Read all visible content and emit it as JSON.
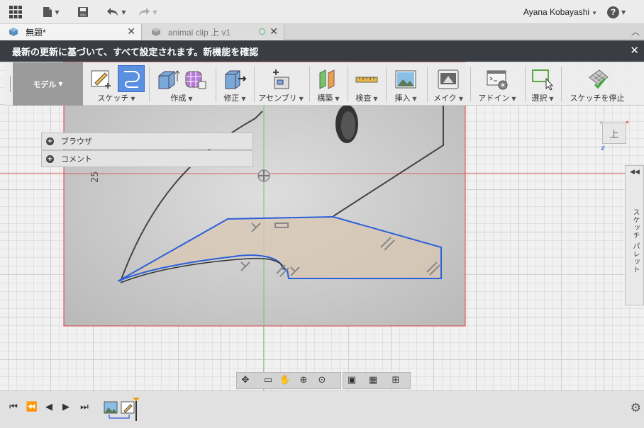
{
  "header": {
    "user_name": "Ayana Kobayashi",
    "help_label": "?"
  },
  "tabs": [
    {
      "label": "無題*"
    },
    {
      "label": "animal clip 上 v1"
    }
  ],
  "notification": {
    "message": "最新の更新に基づいて、すべて設定されます。",
    "link": "新機能を確認"
  },
  "toolbar": {
    "mode": "モデル",
    "groups": [
      {
        "label": "スケッチ"
      },
      {
        "label": "作成"
      },
      {
        "label": "修正"
      },
      {
        "label": "アセンブリ"
      },
      {
        "label": "構築"
      },
      {
        "label": "検査"
      },
      {
        "label": "挿入"
      },
      {
        "label": "メイク"
      },
      {
        "label": "アドイン"
      },
      {
        "label": "選択"
      },
      {
        "label": "スケッチを停止"
      }
    ]
  },
  "browser": {
    "items": [
      {
        "label": "ブラウザ"
      },
      {
        "label": "コメント"
      }
    ]
  },
  "viewcube": {
    "face": "上"
  },
  "dimension": {
    "value": "25"
  },
  "palette": {
    "label": "スケッチ パレット"
  },
  "colors": {
    "accent_blue": "#2b5fd9",
    "notice_bg": "#3a3e44",
    "sketch_fill": "#d9c7b2",
    "origin_red": "#e04040"
  }
}
